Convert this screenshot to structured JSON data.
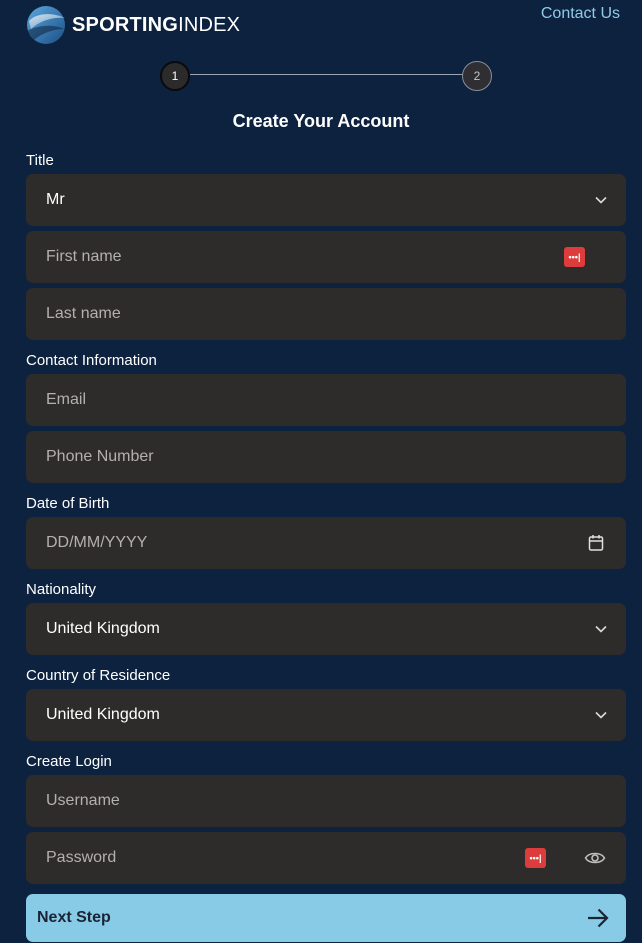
{
  "header": {
    "logo_bold": "SPORTING",
    "logo_light": "INDEX",
    "contact_link": "Contact Us"
  },
  "stepper": {
    "step1": "1",
    "step2": "2"
  },
  "form": {
    "title": "Create Your Account",
    "sections": {
      "title": "Title",
      "contact": "Contact Information",
      "dob": "Date of Birth",
      "nationality": "Nationality",
      "residence": "Country of Residence",
      "login": "Create Login"
    },
    "fields": {
      "title_value": "Mr",
      "first_name_placeholder": "First name",
      "last_name_placeholder": "Last name",
      "email_placeholder": "Email",
      "phone_placeholder": "Phone Number",
      "dob_placeholder": "DD/MM/YYYY",
      "nationality_value": "United Kingdom",
      "residence_value": "United Kingdom",
      "username_placeholder": "Username",
      "password_placeholder": "Password"
    },
    "next_button": "Next Step"
  },
  "icons": {
    "password_manager": "password-manager-icon",
    "chevron": "chevron-down-icon",
    "calendar": "calendar-icon",
    "eye": "eye-icon",
    "arrow": "arrow-right-icon"
  },
  "colors": {
    "background": "#0d223f",
    "field": "#2e2b2b",
    "accent": "#87cbe6",
    "link": "#8fcbe8",
    "password_manager": "#dd3c3c"
  }
}
